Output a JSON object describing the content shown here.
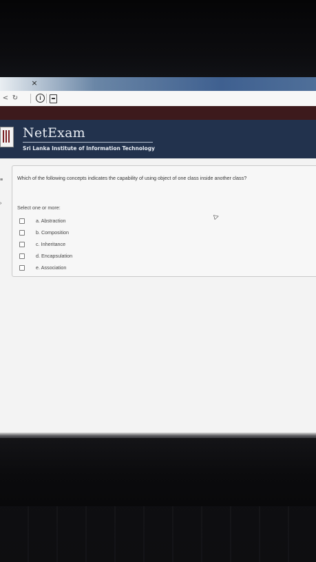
{
  "browser": {
    "tab_close_glyph": "×",
    "nav_reload_glyph": "↻",
    "nav_back_glyph": "<",
    "info_glyph": "i"
  },
  "site": {
    "brand": "NetExam",
    "institute": "Sri Lanka Institute of Information Technology"
  },
  "question": {
    "text": "Which of the following concepts indicates the capability of using object of one class inside another class?",
    "instruction": "Select one or more:",
    "options": [
      {
        "label": "a. Abstraction",
        "checked": false
      },
      {
        "label": "b. Composition",
        "checked": false
      },
      {
        "label": "c. Inheritance",
        "checked": false
      },
      {
        "label": "d. Encapsulation",
        "checked": false
      },
      {
        "label": "e. Association",
        "checked": false
      }
    ]
  },
  "colors": {
    "header_bg": "#22324d",
    "maroon_strip": "#3d1a1c",
    "page_bg": "#f3f3f3"
  }
}
